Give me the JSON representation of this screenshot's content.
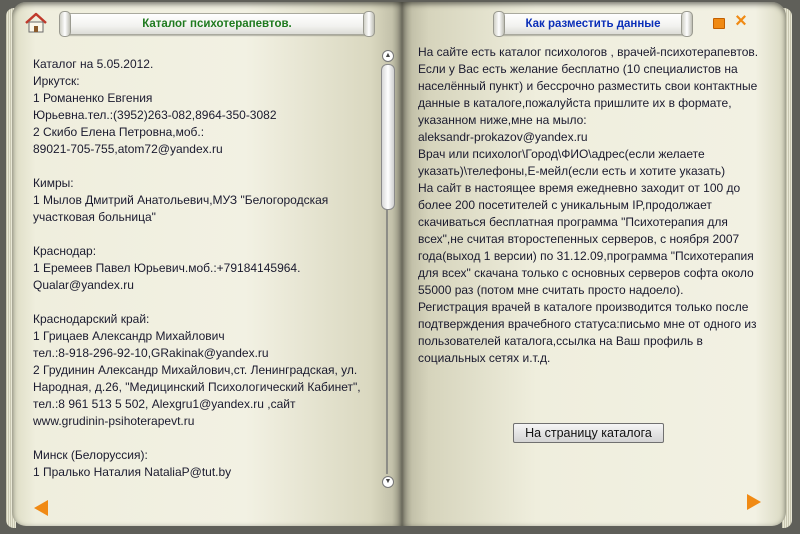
{
  "left_page": {
    "title": "Каталог психотерапевтов.",
    "lines": [
      "Каталог на 5.05.2012.",
      "Иркутск:",
      "1 Романенко Евгения",
      "Юрьевна.тел.:(3952)263-082,8964-350-3082",
      "2 Скибо Елена Петровна,моб.:",
      "89021-705-755,atom72@yandex.ru",
      "",
      "Кимры:",
      "1 Мылов Дмитрий Анатольевич,МУЗ \"Белогородская",
      "участковая больница\"",
      "",
      "Краснодар:",
      "1 Еремеев Павел Юрьевич.моб.:+79184145964.",
      "Qualar@yandex.ru",
      "",
      "Краснодарский край:",
      "1 Грицаев Александр Михайлович",
      "тел.:8-918-296-92-10,GRakinak@yandex.ru",
      "2 Грудинин Александр Михайлович,ст. Ленинградская, ул.",
      "Народная, д.26, \"Медицинский Психологический Кабинет\",",
      "тел.:8 961 513 5 502, Alexgru1@yandex.ru ,сайт",
      "www.grudinin-psihoterapevt.ru",
      "",
      "Минск (Белоруссия):",
      "1 Пралько Наталия NataliaP@tut.by"
    ]
  },
  "right_page": {
    "title": "Как разместить данные",
    "lines": [
      "На сайте есть каталог психологов , врачей-психотерапевтов.",
      "Если у Вас есть желание бесплатно (10 специалистов на",
      "населённый пункт) и бессрочно  разместить свои контактные",
      "данные в каталоге,пожалуйста пришлите их в формате,",
      "указанном ниже,мне на мыло:",
      "aleksandr-prokazov@yandex.ru",
      "Врач или психолог\\Город\\ФИО\\адрес(если желаете",
      "указать)\\телефоны,Е-мейл(если есть и хотите указать)",
      "На сайт в настоящее время ежедневно заходит от 100 до",
      "более 200 посетителей с уникальным IP,продолжает",
      "скачиваться бесплатная программа \"Психотерапия для",
      "всех\",не считая второстепенных серверов, с ноября 2007",
      "года(выход 1 версии) по 31.12.09,программа \"Психотерапия",
      "для всех\" скачана  только с основных серверов софта около",
      "55000 раз (потом мне считать просто надоело).",
      "Регистрация врачей в каталоге производится только после",
      "подтверждения врачебного статуса:письмо мне от одного из",
      "пользователей каталога,ссылка на Ваш профиль в",
      "социальных сетях и.т.д."
    ],
    "catalog_button": "На страницу каталога"
  },
  "icons": {
    "home": "home-icon",
    "minimize": "minimize-icon",
    "close": "close-icon",
    "prev": "arrow-left-icon",
    "next": "arrow-right-icon"
  },
  "colors": {
    "accent": "#f08a14",
    "left_title": "#1f7a1f",
    "right_title": "#0b2fb8"
  },
  "close_glyph": "×"
}
